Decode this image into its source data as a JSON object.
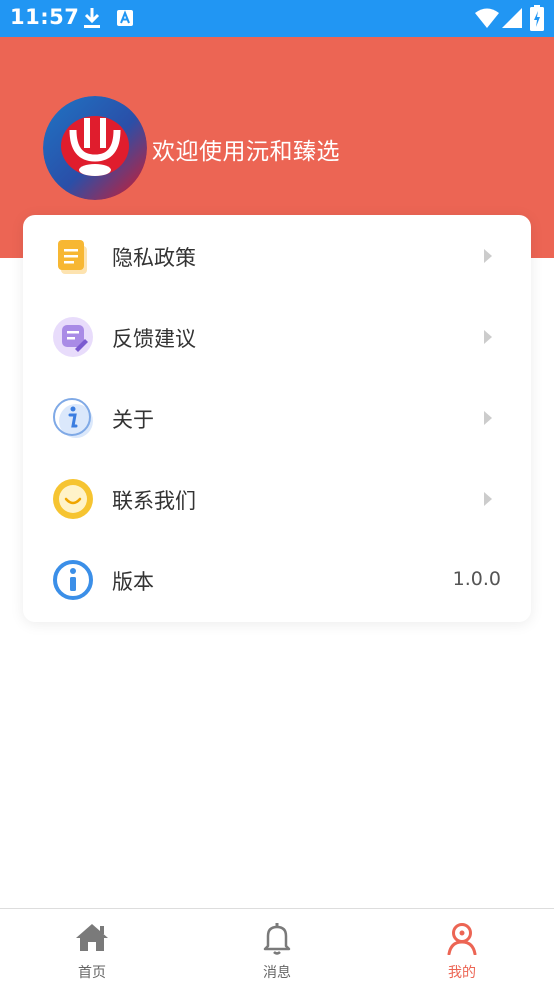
{
  "status_bar": {
    "time": "11:57",
    "icons": [
      "download-icon",
      "accessibility-icon",
      "wifi-icon",
      "cell-signal-icon",
      "battery-charging-icon"
    ],
    "background": "#2196f3"
  },
  "header": {
    "welcome_text": "欢迎使用沅和臻选",
    "background": "#ec6554"
  },
  "menu": {
    "items": [
      {
        "label": "隐私政策",
        "icon": "document-icon",
        "has_arrow": true
      },
      {
        "label": "反馈建议",
        "icon": "feedback-icon",
        "has_arrow": true
      },
      {
        "label": "关于",
        "icon": "about-icon",
        "has_arrow": true
      },
      {
        "label": "联系我们",
        "icon": "contact-icon",
        "has_arrow": true
      },
      {
        "label": "版本",
        "icon": "version-info-icon",
        "value": "1.0.0",
        "has_arrow": false
      }
    ]
  },
  "bottom_nav": {
    "tabs": [
      {
        "label": "首页",
        "icon": "home-icon",
        "active": false
      },
      {
        "label": "消息",
        "icon": "bell-icon",
        "active": false
      },
      {
        "label": "我的",
        "icon": "profile-icon",
        "active": true
      }
    ],
    "active_color": "#ec6554"
  }
}
